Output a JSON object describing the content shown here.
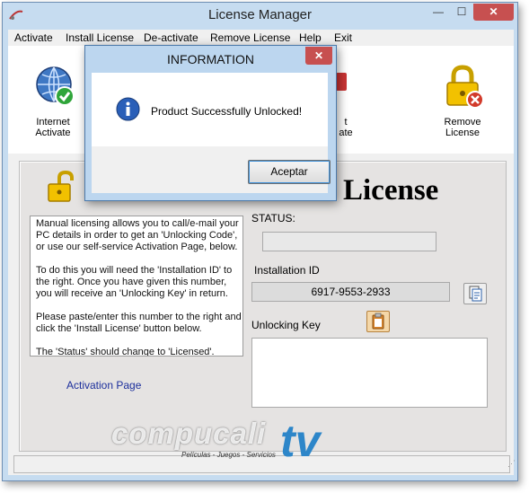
{
  "window": {
    "title": "License Manager",
    "minimize_glyph": "—",
    "maximize_glyph": "☐",
    "close_glyph": "✕"
  },
  "menu": [
    "Activate",
    "Install License",
    "De-activate",
    "Remove License",
    "Help",
    "Exit"
  ],
  "toolbar": {
    "internet_activate": {
      "line1": "Internet",
      "line2": "Activate",
      "icon": "globe-check-icon"
    },
    "partial": {
      "line1": "t",
      "line2": "ate",
      "icon": "partial-icon"
    },
    "remove_license": {
      "line1": "Remove",
      "line2": "License",
      "icon": "padlock-red-x-icon"
    }
  },
  "panel": {
    "heading": "License",
    "info_paragraphs": [
      "Manual licensing allows you to call/e-mail your PC details in order to get an 'Unlocking Code', or use our self-service Activation Page, below.",
      "To do this you will need the 'Installation ID' to the right.  Once you have given this number, you will receive an 'Unlocking Key' in return.",
      "Please paste/enter this number to the right and click the 'Install License' button below.",
      "The 'Status' should change to 'Licensed'."
    ],
    "activation_link": "Activation Page",
    "status_label": "STATUS:",
    "status_value": "",
    "installation_id_label": "Installation ID",
    "installation_id_value": "6917-9553-2933",
    "unlocking_key_label": "Unlocking Key",
    "unlocking_key_value": ""
  },
  "dialog": {
    "title": "INFORMATION",
    "message": "Product Successfully Unlocked!",
    "ok_label": "Aceptar",
    "close_glyph": "✕"
  },
  "watermark": {
    "brand": "compucalitv",
    "tagline": "Películas - Juegos - Servicios",
    "brand_part1": "compucali",
    "brand_part2": "tv"
  },
  "colors": {
    "accent_blue": "#3c8fd8",
    "close_red": "#c75050",
    "link_blue": "#1c2f9c"
  }
}
